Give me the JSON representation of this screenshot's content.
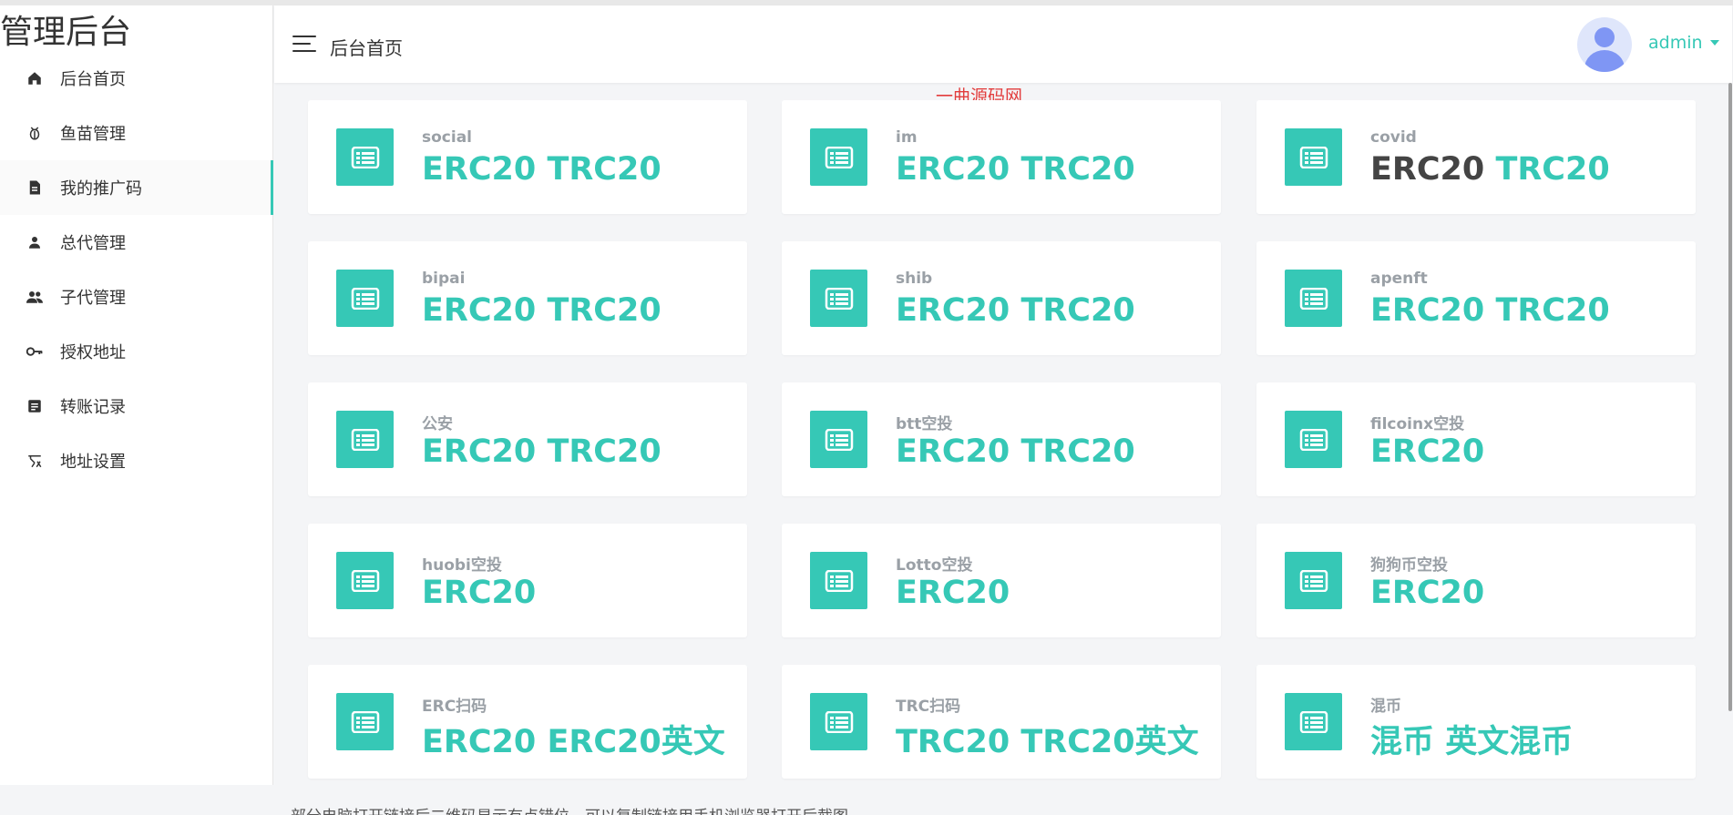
{
  "brand": "管理后台",
  "header": {
    "title": "后台首页",
    "user": "admin"
  },
  "watermark": "一曲源码网",
  "nav": [
    {
      "label": "后台首页",
      "icon": "home-icon",
      "active": false
    },
    {
      "label": "鱼苗管理",
      "icon": "bug-icon",
      "active": false
    },
    {
      "label": "我的推广码",
      "icon": "document-icon",
      "active": true
    },
    {
      "label": "总代管理",
      "icon": "person-icon",
      "active": false
    },
    {
      "label": "子代管理",
      "icon": "people-icon",
      "active": false
    },
    {
      "label": "授权地址",
      "icon": "key-icon",
      "active": false
    },
    {
      "label": "转账记录",
      "icon": "list-icon",
      "active": false
    },
    {
      "label": "地址设置",
      "icon": "settings-tool-icon",
      "active": false
    }
  ],
  "cards": [
    {
      "name": "social",
      "links": [
        "ERC20",
        "TRC20"
      ],
      "dark": []
    },
    {
      "name": "im",
      "links": [
        "ERC20",
        "TRC20"
      ],
      "dark": []
    },
    {
      "name": "covid",
      "links": [
        "ERC20",
        "TRC20"
      ],
      "dark": [
        0
      ]
    },
    {
      "name": "bipai",
      "links": [
        "ERC20",
        "TRC20"
      ],
      "dark": []
    },
    {
      "name": "shib",
      "links": [
        "ERC20",
        "TRC20"
      ],
      "dark": []
    },
    {
      "name": "apenft",
      "links": [
        "ERC20",
        "TRC20"
      ],
      "dark": []
    },
    {
      "name": "公安",
      "links": [
        "ERC20",
        "TRC20"
      ],
      "dark": []
    },
    {
      "name": "btt空投",
      "links": [
        "ERC20",
        "TRC20"
      ],
      "dark": []
    },
    {
      "name": "filcoinx空投",
      "links": [
        "ERC20"
      ],
      "dark": []
    },
    {
      "name": "huobi空投",
      "links": [
        "ERC20"
      ],
      "dark": []
    },
    {
      "name": "Lotto空投",
      "links": [
        "ERC20"
      ],
      "dark": []
    },
    {
      "name": "狗狗币空投",
      "links": [
        "ERC20"
      ],
      "dark": []
    },
    {
      "name": "ERC扫码",
      "links": [
        "ERC20",
        "ERC20英文"
      ],
      "dark": []
    },
    {
      "name": "TRC扫码",
      "links": [
        "TRC20",
        "TRC20英文"
      ],
      "dark": []
    },
    {
      "name": "混币",
      "links": [
        "混币",
        "英文混币"
      ],
      "dark": []
    }
  ],
  "footer_note": "部分电脑打开链接后二维码显示有点错位，可以复制链接用手机浏览器打开后截图",
  "colors": {
    "accent": "#36c8b6",
    "avatar": "#7f96f4",
    "watermark": "#e23c3c"
  }
}
